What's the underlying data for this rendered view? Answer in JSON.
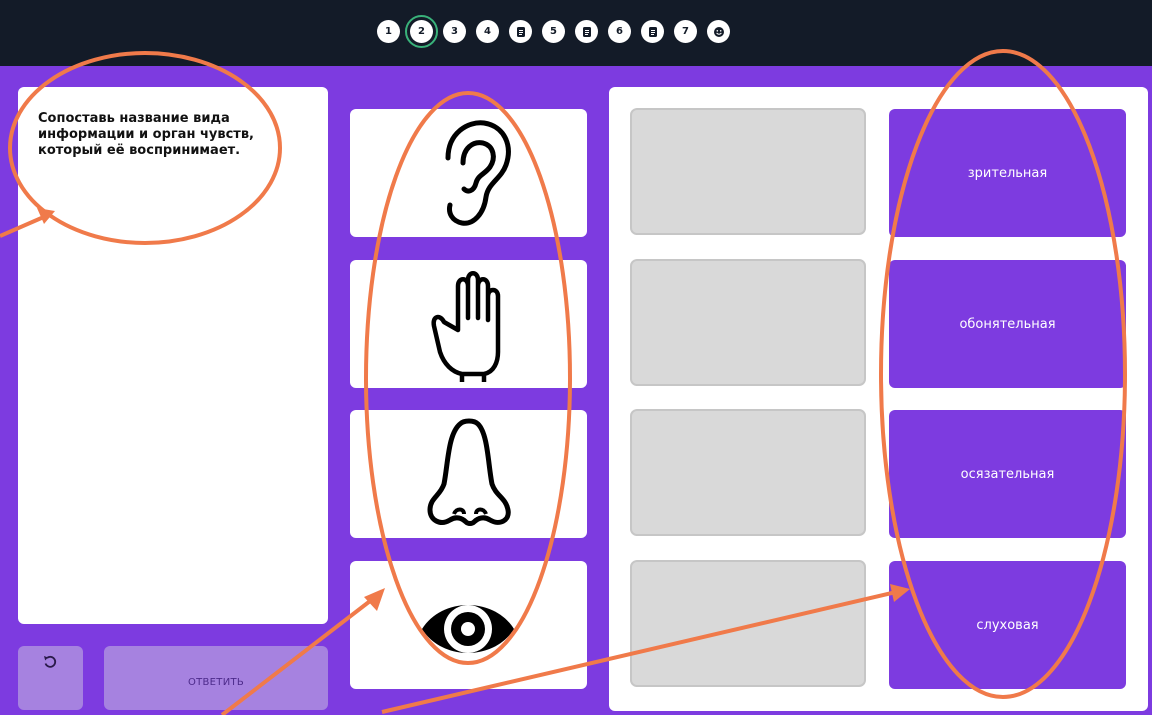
{
  "nav": {
    "items": [
      {
        "label": "1",
        "type": "number"
      },
      {
        "label": "2",
        "type": "number",
        "current": true
      },
      {
        "label": "3",
        "type": "number"
      },
      {
        "label": "4",
        "type": "number"
      },
      {
        "icon": "document-icon",
        "type": "icon"
      },
      {
        "label": "5",
        "type": "number"
      },
      {
        "icon": "document-icon",
        "type": "icon"
      },
      {
        "label": "6",
        "type": "number"
      },
      {
        "icon": "document-icon",
        "type": "icon"
      },
      {
        "label": "7",
        "type": "number"
      },
      {
        "icon": "smiley-icon",
        "type": "icon"
      }
    ]
  },
  "question": {
    "text": "Сопоставь название вида информации и орган чувств, который её воспринимает."
  },
  "controls": {
    "reset_icon": "undo-icon",
    "answer_label": "ОТВЕТИТЬ"
  },
  "images": [
    {
      "icon": "ear-icon"
    },
    {
      "icon": "hand-icon"
    },
    {
      "icon": "nose-icon"
    },
    {
      "icon": "eye-icon"
    }
  ],
  "options": [
    {
      "label": "зрительная"
    },
    {
      "label": "обонятельная"
    },
    {
      "label": "осязательная"
    },
    {
      "label": "слуховая"
    }
  ],
  "colors": {
    "background": "#7d3be0",
    "topbar": "#131b28",
    "annotation": "#f07a4a",
    "current_ring": "#39b27a"
  }
}
